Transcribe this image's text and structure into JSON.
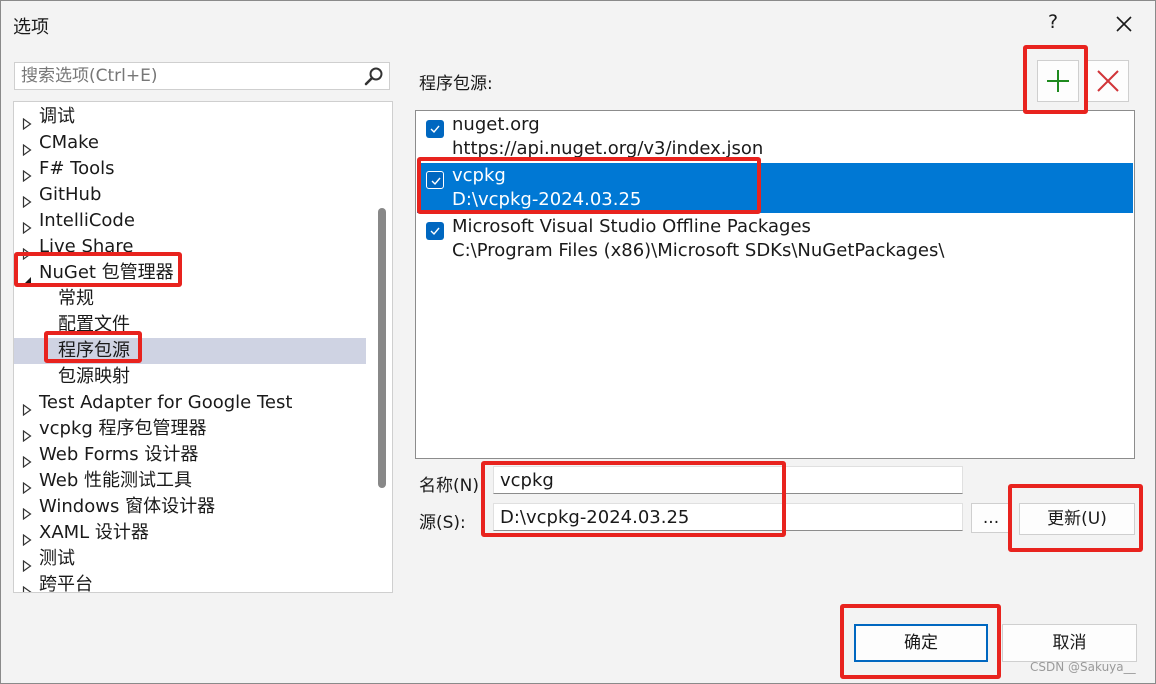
{
  "window": {
    "title": "选项",
    "help_label": "?"
  },
  "search": {
    "placeholder": "搜索选项(Ctrl+E)",
    "value": ""
  },
  "tree": {
    "items": [
      {
        "label": "调试",
        "expanded": false
      },
      {
        "label": "CMake",
        "expanded": false
      },
      {
        "label": "F# Tools",
        "expanded": false
      },
      {
        "label": "GitHub",
        "expanded": false
      },
      {
        "label": "IntelliCode",
        "expanded": false
      },
      {
        "label": "Live Share",
        "expanded": false
      },
      {
        "label": "NuGet 包管理器",
        "expanded": true
      },
      {
        "label": "常规"
      },
      {
        "label": "配置文件"
      },
      {
        "label": "程序包源",
        "selected": true
      },
      {
        "label": "包源映射"
      },
      {
        "label": "Test Adapter for Google Test",
        "expanded": false
      },
      {
        "label": "vcpkg 程序包管理器",
        "expanded": false
      },
      {
        "label": "Web Forms 设计器",
        "expanded": false
      },
      {
        "label": "Web 性能测试工具",
        "expanded": false
      },
      {
        "label": "Windows 窗体设计器",
        "expanded": false
      },
      {
        "label": "XAML 设计器",
        "expanded": false
      },
      {
        "label": "测试",
        "expanded": false
      },
      {
        "label": "跨平台",
        "expanded": false
      }
    ]
  },
  "sources": {
    "label": "程序包源:",
    "items": [
      {
        "name": "nuget.org",
        "url": "https://api.nuget.org/v3/index.json",
        "checked": true
      },
      {
        "name": "vcpkg",
        "url": "D:\\vcpkg-2024.03.25",
        "checked": true,
        "selected": true
      },
      {
        "name": "Microsoft Visual Studio Offline Packages",
        "url": "C:\\Program Files (x86)\\Microsoft SDKs\\NuGetPackages\\",
        "checked": true
      }
    ]
  },
  "form": {
    "name_label": "名称(N):",
    "name_value": "vcpkg",
    "source_label": "源(S):",
    "source_value": "D:\\vcpkg-2024.03.25",
    "browse_label": "...",
    "update_label": "更新(U)"
  },
  "footer": {
    "ok_label": "确定",
    "cancel_label": "取消"
  },
  "watermark": "CSDN @Sakuya__",
  "colors": {
    "accent": "#0078d4",
    "checkbox": "#0067c0",
    "highlight": "#e8231e",
    "add_icon": "#1e8a1e",
    "delete_icon": "#d13438"
  }
}
